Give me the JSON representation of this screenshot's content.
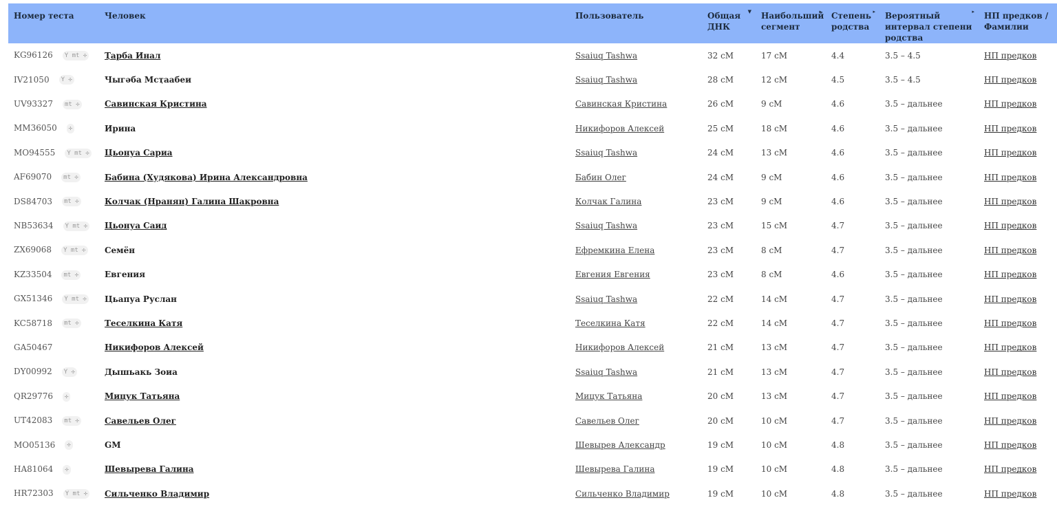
{
  "columns": {
    "test": "Номер теста",
    "person": "Человек",
    "user": "Пользователь",
    "total": "Общая ДНК",
    "longest": "Наибольший сегмент",
    "degree": "Степень родства",
    "interval": "Вероятный интервал степени родства",
    "ancestors": "НП предков / Фамилии"
  },
  "icons": {
    "sort": "sort-arrow-icon",
    "y": "y-haplogroup-badge",
    "mt": "mt-haplogroup-badge",
    "x": "x-chromosome-badge"
  },
  "rows": [
    {
      "test": "KG96126",
      "y": true,
      "mt": true,
      "x": true,
      "person": "Ҭарба Инал",
      "personLink": true,
      "user": "Ssaiuq Tashwa",
      "total": "32 cM",
      "longest": "17 cM",
      "degree": "4.4",
      "interval": "3.5 – 4.5",
      "ancestors": "НП предков"
    },
    {
      "test": "IV21050",
      "y": true,
      "mt": false,
      "x": true,
      "person": "Чыгәба Мсҭаабеи",
      "personLink": false,
      "user": "Ssaiuq Tashwa",
      "total": "28 cM",
      "longest": "12 cM",
      "degree": "4.5",
      "interval": "3.5 – 4.5",
      "ancestors": "НП предков"
    },
    {
      "test": "UV93327",
      "y": false,
      "mt": true,
      "x": true,
      "person": "Савинская Кристина",
      "personLink": true,
      "user": "Савинская Кристина",
      "total": "26 cM",
      "longest": "9 cM",
      "degree": "4.6",
      "interval": "3.5 – дальнее",
      "ancestors": "НП предков"
    },
    {
      "test": "MM36050",
      "y": false,
      "mt": false,
      "x": true,
      "person": "Ирина",
      "personLink": false,
      "user": "Никифоров Алексей",
      "total": "25 cM",
      "longest": "18 cM",
      "degree": "4.6",
      "interval": "3.5 – дальнее",
      "ancestors": "НП предков"
    },
    {
      "test": "MO94555",
      "y": true,
      "mt": true,
      "x": true,
      "person": "Цьонуа Сариа",
      "personLink": true,
      "user": "Ssaiuq Tashwa",
      "total": "24 cM",
      "longest": "13 cM",
      "degree": "4.6",
      "interval": "3.5 – дальнее",
      "ancestors": "НП предков"
    },
    {
      "test": "AF69070",
      "y": false,
      "mt": true,
      "x": true,
      "person": "Бабина (Худякова) Ирина Александровна",
      "personLink": true,
      "user": "Бабин Олег",
      "total": "24 cM",
      "longest": "9 cM",
      "degree": "4.6",
      "interval": "3.5 – дальнее",
      "ancestors": "НП предков"
    },
    {
      "test": "DS84703",
      "y": false,
      "mt": true,
      "x": true,
      "person": "Колчак (Нранян) Галина Шакровна",
      "personLink": true,
      "user": "Колчак Галина",
      "total": "23 cM",
      "longest": "9 cM",
      "degree": "4.6",
      "interval": "3.5 – дальнее",
      "ancestors": "НП предков"
    },
    {
      "test": "NB53634",
      "y": true,
      "mt": true,
      "x": true,
      "person": "Цьонуа Саид",
      "personLink": true,
      "user": "Ssaiuq Tashwa",
      "total": "23 cM",
      "longest": "15 cM",
      "degree": "4.7",
      "interval": "3.5 – дальнее",
      "ancestors": "НП предков"
    },
    {
      "test": "ZX69068",
      "y": true,
      "mt": true,
      "x": true,
      "person": "Семён",
      "personLink": false,
      "user": "Ефремкина Елена",
      "total": "23 cM",
      "longest": "8 cM",
      "degree": "4.7",
      "interval": "3.5 – дальнее",
      "ancestors": "НП предков"
    },
    {
      "test": "KZ33504",
      "y": false,
      "mt": true,
      "x": true,
      "person": "Евгения",
      "personLink": false,
      "user": "Евгения Евгения",
      "total": "23 cM",
      "longest": "8 cM",
      "degree": "4.6",
      "interval": "3.5 – дальнее",
      "ancestors": "НП предков"
    },
    {
      "test": "GX51346",
      "y": true,
      "mt": true,
      "x": true,
      "person": "Цьапуа Руслан",
      "personLink": false,
      "user": "Ssaiuq Tashwa",
      "total": "22 cM",
      "longest": "14 cM",
      "degree": "4.7",
      "interval": "3.5 – дальнее",
      "ancestors": "НП предков"
    },
    {
      "test": "KC58718",
      "y": false,
      "mt": true,
      "x": true,
      "person": "Теселкина Катя",
      "personLink": true,
      "user": "Теселкина Катя",
      "total": "22 cM",
      "longest": "14 cM",
      "degree": "4.7",
      "interval": "3.5 – дальнее",
      "ancestors": "НП предков"
    },
    {
      "test": "GA50467",
      "y": false,
      "mt": false,
      "x": false,
      "person": "Никифоров Алексей",
      "personLink": true,
      "user": "Никифоров Алексей",
      "total": "21 cM",
      "longest": "13 cM",
      "degree": "4.7",
      "interval": "3.5 – дальнее",
      "ancestors": "НП предков"
    },
    {
      "test": "DY00992",
      "y": true,
      "mt": false,
      "x": true,
      "person": "Дышьакь Зоиа",
      "personLink": false,
      "user": "Ssaiuq Tashwa",
      "total": "21 cM",
      "longest": "13 cM",
      "degree": "4.7",
      "interval": "3.5 – дальнее",
      "ancestors": "НП предков"
    },
    {
      "test": "QR29776",
      "y": false,
      "mt": false,
      "x": true,
      "person": "Мицук Татьяна",
      "personLink": true,
      "user": "Мицук Татьяна",
      "total": "20 cM",
      "longest": "13 cM",
      "degree": "4.7",
      "interval": "3.5 – дальнее",
      "ancestors": "НП предков"
    },
    {
      "test": "UT42083",
      "y": false,
      "mt": true,
      "x": true,
      "person": "Савельев Олег",
      "personLink": true,
      "user": "Савельев Олег",
      "total": "20 cM",
      "longest": "10 cM",
      "degree": "4.7",
      "interval": "3.5 – дальнее",
      "ancestors": "НП предков"
    },
    {
      "test": "MO05136",
      "y": false,
      "mt": false,
      "x": true,
      "person": "GM",
      "personLink": false,
      "user": "Шевырев Александр",
      "total": "19 cM",
      "longest": "10 cM",
      "degree": "4.8",
      "interval": "3.5 – дальнее",
      "ancestors": "НП предков"
    },
    {
      "test": "HA81064",
      "y": false,
      "mt": false,
      "x": true,
      "person": "Шевырева Галина",
      "personLink": true,
      "user": "Шевырева Галина",
      "total": "19 cM",
      "longest": "10 cM",
      "degree": "4.8",
      "interval": "3.5 – дальнее",
      "ancestors": "НП предков"
    },
    {
      "test": "HR72303",
      "y": true,
      "mt": true,
      "x": true,
      "person": "Сильченко Владимир",
      "personLink": true,
      "user": "Сильченко Владимир",
      "total": "19 cM",
      "longest": "10 cM",
      "degree": "4.8",
      "interval": "3.5 – дальнее",
      "ancestors": "НП предков"
    }
  ]
}
